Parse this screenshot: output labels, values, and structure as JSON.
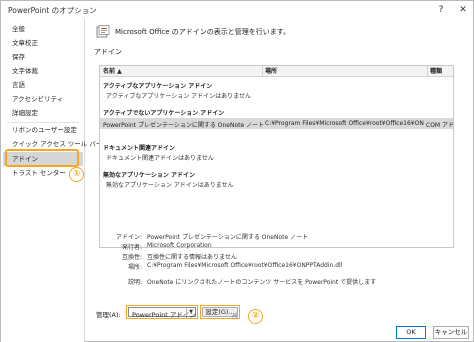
{
  "window": {
    "title": "PowerPoint のオプション",
    "help_label": "?",
    "close_label": "✕"
  },
  "sidebar": {
    "items": [
      {
        "label": "全般"
      },
      {
        "label": "文章校正"
      },
      {
        "label": "保存"
      },
      {
        "label": "文字体裁"
      },
      {
        "label": "言語"
      },
      {
        "label": "アクセシビリティ"
      },
      {
        "label": "詳細設定"
      },
      {
        "label": "リボンのユーザー設定"
      },
      {
        "label": "クイック アクセス ツール バー"
      },
      {
        "label": "アドイン"
      },
      {
        "label": "トラスト センター"
      }
    ],
    "selected_index": 9
  },
  "annotations": {
    "badge1": "①",
    "badge2": "②",
    "accent_color": "#f5a623"
  },
  "main": {
    "header_text": "Microsoft Office のアドインの表示と管理を行います。",
    "section_label": "アドイン",
    "table": {
      "columns": [
        "名前 ▲",
        "場所",
        "種類"
      ],
      "groups": [
        {
          "title": "アクティブなアプリケーション アドイン",
          "empty_text": "アクティブなアプリケーション アドインはありません"
        },
        {
          "title": "アクティブでないアプリケーション アドイン"
        },
        {
          "title": "ドキュメント関連アドイン",
          "empty_text": "ドキュメント関連アドインはありません"
        },
        {
          "title": "無効なアプリケーション アドイン",
          "empty_text": "無効なアプリケーション アドインはありません"
        }
      ],
      "selected_row": {
        "name": "PowerPoint プレゼンテーションに関する OneNote ノート",
        "location": "C:¥Program Files¥Microsoft Office¥root¥Office16¥ON",
        "type": "COM アドイン"
      }
    },
    "details": [
      {
        "label": "アドイン:",
        "value": "PowerPoint プレゼンテーションに関する OneNote ノート"
      },
      {
        "label": "発行者:",
        "value": "Microsoft Corporation"
      },
      {
        "label": "互換性:",
        "value": "互換性に関する情報はありません"
      },
      {
        "label": "場所:",
        "value": "C:¥Program Files¥Microsoft Office¥root¥Office16¥ONPPTAddin.dll"
      },
      {
        "label": "説明:",
        "value": "OneNote にリンクされたノートのコンテンツ サービスを PowerPoint で提供します"
      }
    ],
    "manage": {
      "label": "管理(A):",
      "selected": "PowerPoint アドイン",
      "go_label": "設定(G)..."
    }
  },
  "footer": {
    "ok_label": "OK",
    "cancel_label": "キャンセル"
  }
}
